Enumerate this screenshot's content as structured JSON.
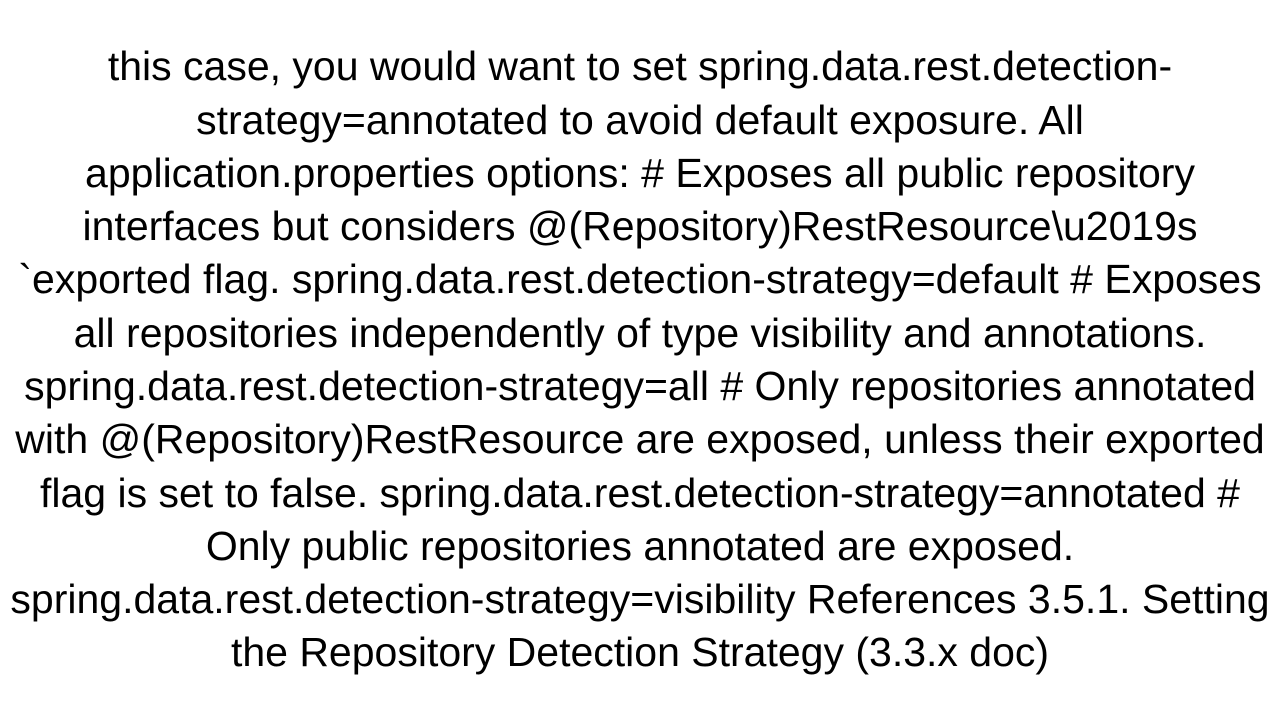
{
  "body_text": "this case, you would want to set spring.data.rest.detection-strategy=annotated to avoid default exposure. All application.properties options: # Exposes all public repository interfaces but considers @(Repository)RestResource\\u2019s `exported flag. spring.data.rest.detection-strategy=default  # Exposes all repositories independently of type visibility and annotations. spring.data.rest.detection-strategy=all  # Only repositories annotated with @(Repository)RestResource are exposed, unless their exported flag is set to false. spring.data.rest.detection-strategy=annotated  # Only public repositories annotated are exposed. spring.data.rest.detection-strategy=visibility  References 3.5.1. Setting the Repository Detection Strategy (3.3.x doc)"
}
